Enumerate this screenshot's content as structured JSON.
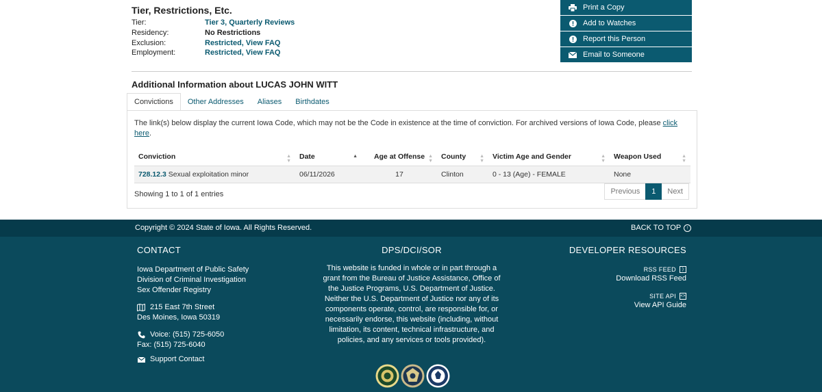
{
  "tier_section": {
    "title": "Tier, Restrictions, Etc.",
    "rows": [
      {
        "label": "Tier:",
        "value": "Tier 3, Quarterly Reviews"
      },
      {
        "label": "Residency:",
        "value": "No Restrictions"
      },
      {
        "label": "Exclusion:",
        "value": "Restricted, View FAQ"
      },
      {
        "label": "Employment:",
        "value": "Restricted, View FAQ"
      }
    ]
  },
  "actions": [
    {
      "label": "Print a Copy",
      "icon": "printer-icon"
    },
    {
      "label": "Add to Watches",
      "icon": "info-icon"
    },
    {
      "label": "Report this Person",
      "icon": "info-icon"
    },
    {
      "label": "Email to Someone",
      "icon": "envelope-icon"
    }
  ],
  "additional": {
    "title": "Additional Information about LUCAS JOHN WITT",
    "tabs": [
      "Convictions",
      "Other Addresses",
      "Aliases",
      "Birthdates"
    ],
    "note": "The link(s) below display the current Iowa Code, which may not be the Code in existence at the time of conviction. For archived versions of Iowa Code, please ",
    "note_link": "click here",
    "note_end": ".",
    "table": {
      "headers": [
        "Conviction",
        "Date",
        "Age at Offense",
        "County",
        "Victim Age and Gender",
        "Weapon Used"
      ],
      "rows": [
        {
          "code": "728.12.3",
          "desc": "Sexual exploitation minor",
          "date": "06/11/2026",
          "age": "17",
          "county": "Clinton",
          "victim": "0 - 13 (Age) - FEMALE",
          "weapon": "None"
        }
      ]
    },
    "showing": "Showing 1 to 1 of 1 entries",
    "pager": {
      "prev": "Previous",
      "page": "1",
      "next": "Next"
    }
  },
  "footer": {
    "copyright": "Copyright © 2024 State of Iowa. All Rights Reserved.",
    "back_to_top": "BACK TO TOP",
    "contact": {
      "title": "CONTACT",
      "org1": "Iowa Department of Public Safety",
      "org2": "Division of Criminal Investigation",
      "org3": "Sex Offender Registry",
      "addr1": "215 East 7th Street",
      "addr2": "Des Moines, Iowa 50319",
      "voice": "Voice: (515) 725-6050",
      "fax": "Fax: (515) 725-6040",
      "support": "Support Contact"
    },
    "mid": {
      "title": "DPS/DCI/SOR",
      "text": "This website is funded in whole or in part through a grant from the Bureau of Justice Assistance, Office of the Justice Programs, U.S. Department of Justice. Neither the U.S. Department of Justice nor any of its components operate, control, are responsible for, or necessarily endorse, this website (including, without limitation, its content, technical infrastructure, and policies, and any services or tools provided)."
    },
    "dev": {
      "title": "DEVELOPER RESOURCES",
      "rss_label": "RSS FEED",
      "rss_link": "Download RSS Feed",
      "api_label": "SITE API",
      "api_link": "View API Guide"
    }
  },
  "colors": {
    "primary": "#0b5a70",
    "footer": "#0b4a5c",
    "footer_bar": "#063b4b"
  }
}
